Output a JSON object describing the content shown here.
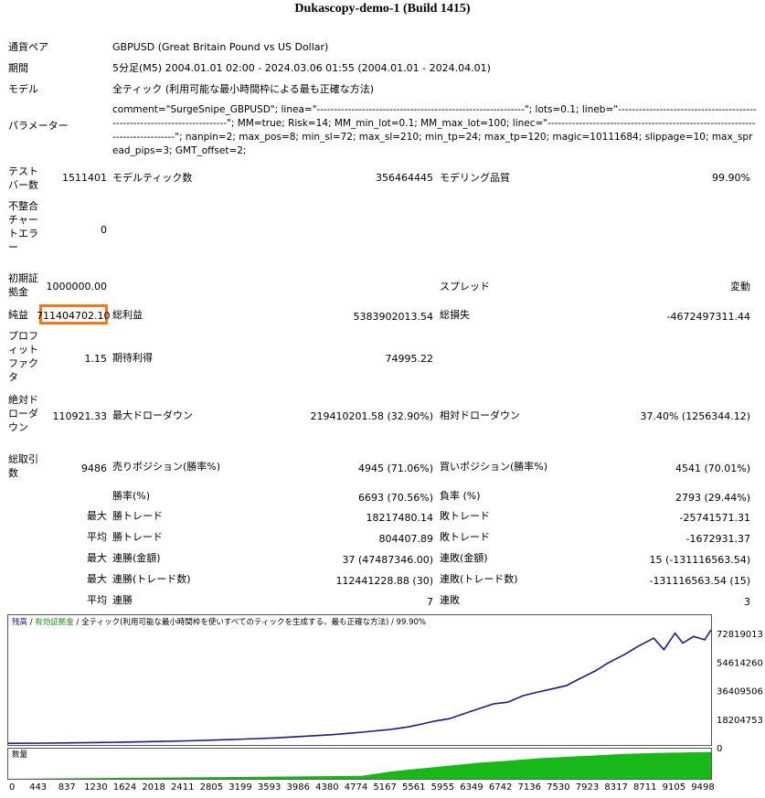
{
  "report": {
    "title": "Dukascopy-demo-1 (Build 1415)",
    "symbol_label": "通貨ペア",
    "symbol_value": "GBPUSD (Great Britain Pound vs US Dollar)",
    "period_label": "期間",
    "period_value": "5分足(M5) 2004.01.01 02:00 - 2024.03.06 01:55 (2004.01.01 - 2024.04.01)",
    "model_label": "モデル",
    "model_value": "全ティック (利用可能な最小時間枠による最も正確な方法)",
    "params_label": "パラメーター",
    "params_value": "comment=\"SurgeSnipe_GBPUSD\"; linea=\"------------------------------------------------------------\"; lots=0.1; lineb=\"-------------------------------------------------------------------------\"; MM=true; Risk=14; MM_min_lot=0.1; MM_max_lot=100; linec=\"------------------------------------------------------------------------------\"; nanpin=2; max_pos=8; min_sl=72; max_sl=210; min_tp=24; max_tp=120; magic=10111684; slippage=10; max_spread_pips=3; GMT_offset=2;"
  },
  "stats": {
    "bars_label": "テストバー数",
    "bars_value": "1511401",
    "ticks_label": "モデルティック数",
    "ticks_value": "356464445",
    "quality_label": "モデリング品質",
    "quality_value": "99.90%",
    "mismatch_label": "不整合チャートエラー",
    "mismatch_value": "0",
    "deposit_label": "初期証拠金",
    "deposit_value": "1000000.00",
    "spread_label": "スプレッド",
    "spread_value": "変動",
    "net_label": "純益",
    "net_value": "711404702.10",
    "gross_profit_label": "総利益",
    "gross_profit_value": "5383902013.54",
    "gross_loss_label": "総損失",
    "gross_loss_value": "-4672497311.44",
    "pf_label": "プロフィットファクタ",
    "pf_value": "1.15",
    "payoff_label": "期待利得",
    "payoff_value": "74995.22",
    "abs_dd_label": "絶対ドローダウン",
    "abs_dd_value": "110921.33",
    "max_dd_label": "最大ドローダウン",
    "max_dd_value": "219410201.58 (32.90%)",
    "rel_dd_label": "相対ドローダウン",
    "rel_dd_value": "37.40% (1256344.12)",
    "trades_label": "総取引数",
    "trades_value": "9486",
    "short_label": "売りポジション(勝率%)",
    "short_value": "4945 (71.06%)",
    "long_label": "買いポジション(勝率%)",
    "long_value": "4541 (70.01%)",
    "win_label": "勝率(%)",
    "win_value": "6693 (70.56%)",
    "loss_label": "負率 (%)",
    "loss_value": "2793 (29.44%)",
    "max_label": "最大",
    "avg_label": "平均",
    "largest_win_label": "勝トレード",
    "largest_win_value": "18217480.14",
    "largest_loss_label": "敗トレード",
    "largest_loss_value": "-25741571.31",
    "avg_win_label": "勝トレード",
    "avg_win_value": "804407.89",
    "avg_loss_label": "敗トレード",
    "avg_loss_value": "-1672931.37",
    "cons_wins_label": "連勝(金額)",
    "cons_wins_value": "37 (47487346.00)",
    "cons_losses_label": "連敗(金額)",
    "cons_losses_value": "15 (-131116563.54)",
    "cons_profit_label": "連勝(トレード数)",
    "cons_profit_value": "112441228.88 (30)",
    "cons_loss_label": "連敗(トレード数)",
    "cons_loss_value": "-131116563.54 (15)",
    "avg_cons_wins_label": "連勝",
    "avg_cons_wins_value": "7",
    "avg_cons_losses_label": "連敗",
    "avg_cons_losses_value": "3"
  },
  "chart_legend": {
    "balance": "残高",
    "sep1": " / ",
    "equity": "有効証拠金",
    "sep2": " / ",
    "model": "全ティック(利用可能な最小時間枠を使いすべてのティックを生成する、最も正確な方法)",
    "quality": " / 99.90%",
    "volume_label": "数量"
  },
  "colors": {
    "balance": "#1a1a8c",
    "equity": "#1a8c1a",
    "volume": "#18b818",
    "highlight": "#f07a1a"
  },
  "chart_data": {
    "type": "line",
    "title": "",
    "y_ticks": [
      "72819013",
      "54614260",
      "36409506",
      "18204753",
      "0"
    ],
    "ylim": [
      0,
      72819013
    ],
    "x_ticks": [
      "0",
      "443",
      "837",
      "1230",
      "1624",
      "2018",
      "2411",
      "2805",
      "3199",
      "3593",
      "3986",
      "4380",
      "4774",
      "5167",
      "5561",
      "5955",
      "6349",
      "6742",
      "7136",
      "7530",
      "7923",
      "8317",
      "8711",
      "9105",
      "9498"
    ],
    "xlim": [
      0,
      9486
    ],
    "series": [
      {
        "name": "残高",
        "x": [
          0,
          443,
          837,
          1230,
          1624,
          2018,
          2411,
          2805,
          3199,
          3593,
          3986,
          4380,
          4774,
          5167,
          5400,
          5561,
          5755,
          5955,
          6150,
          6349,
          6550,
          6742,
          6950,
          7136,
          7330,
          7530,
          7700,
          7923,
          8100,
          8317,
          8500,
          8711,
          8850,
          9000,
          9105,
          9250,
          9400,
          9486
        ],
        "values": [
          1000000,
          1100000,
          1300000,
          1500000,
          1800000,
          2100000,
          2500000,
          3000000,
          3600000,
          4300000,
          5200000,
          6300000,
          7800000,
          9500000,
          11000000,
          12500000,
          14500000,
          16000000,
          19000000,
          22000000,
          25000000,
          26000000,
          30000000,
          32000000,
          34000000,
          36000000,
          40000000,
          45000000,
          50000000,
          55000000,
          60000000,
          65000000,
          58000000,
          68000000,
          62000000,
          66000000,
          64000000,
          70000000
        ]
      }
    ],
    "volume": {
      "x": [
        0,
        4774,
        5167,
        5561,
        5955,
        6349,
        6742,
        7136,
        7530,
        7923,
        8317,
        8711,
        9105,
        9486
      ],
      "values": [
        0,
        0.1,
        0.25,
        0.35,
        0.45,
        0.55,
        0.62,
        0.7,
        0.75,
        0.8,
        0.85,
        0.88,
        0.9,
        0.92
      ]
    }
  }
}
